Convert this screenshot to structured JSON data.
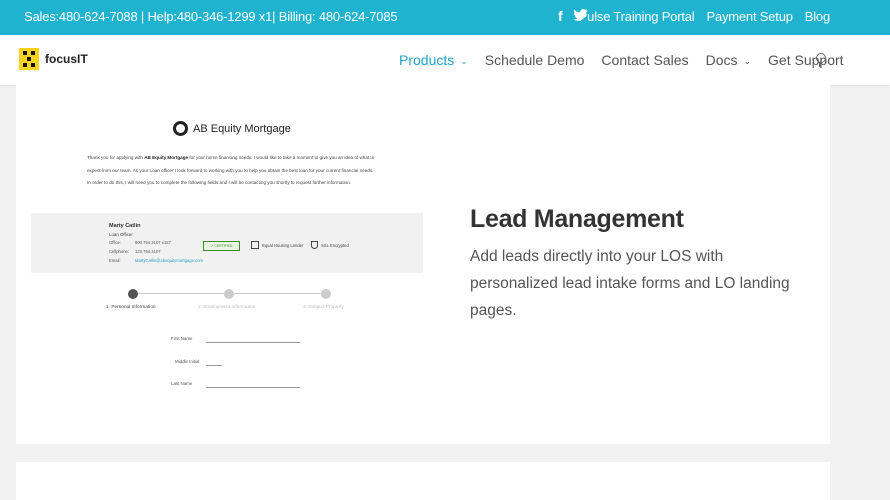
{
  "topbar": {
    "contact": "Sales:480-624-7088 | Help:480-346-1299 x1| Billing: 480-624-7085",
    "social": [
      "facebook-icon",
      "twitter-icon"
    ],
    "links": [
      "Pulse Training Portal",
      "Payment Setup",
      "Blog"
    ],
    "bg_color": "#1fb3cf"
  },
  "nav": {
    "logo_text": "focusIT",
    "items": [
      {
        "label": "Products",
        "has_dropdown": true,
        "active": true
      },
      {
        "label": "Schedule Demo",
        "has_dropdown": false
      },
      {
        "label": "Contact Sales",
        "has_dropdown": false
      },
      {
        "label": "Docs",
        "has_dropdown": true
      },
      {
        "label": "Get Support",
        "has_dropdown": false
      }
    ],
    "accent_color": "#1fa4c1"
  },
  "preview": {
    "brand": "AB Equity Mortgage",
    "intro_1": "Thank you for applying with ",
    "intro_brand": "AB Equity Mortgage",
    "intro_2": " for your home financing needs. I would like to take a moment to give you an idea of what to expect from our team. As your Loan officer I look forward to working with you to help you obtain the best loan for your current financial needs. In order to do this, I will need you to complete the following fields and I will be contacting you shortly to request further information.",
    "officer": {
      "name": "Marty Catlin",
      "title": "Loan Officer",
      "rows": [
        {
          "label": "Office:",
          "value": "800.754.3107 x157"
        },
        {
          "label": "Cellphone:",
          "value": "123.754.3107"
        },
        {
          "label": "Email:",
          "value": "MartyCatlin@abequitymortgage.com"
        }
      ],
      "badges": [
        "Equal Housing Lender",
        "SSL Encrypted"
      ]
    },
    "steps": [
      "1. Personal Information",
      "2. Employment Information",
      "3. Subject Property"
    ],
    "fields": [
      "First Name",
      "Middle Initial",
      "Last Name"
    ]
  },
  "feature": {
    "title": "Lead Management",
    "description": "Add leads directly into your LOS with personalized lead intake forms and LO landing pages."
  }
}
